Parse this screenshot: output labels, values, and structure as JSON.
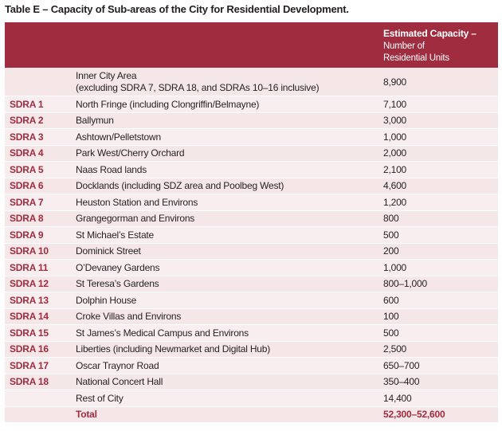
{
  "title": "Table E – Capacity of Sub-areas of the City for Residential Development.",
  "header": {
    "capacity_title": "Estimated Capacity –",
    "capacity_subtitle": "Number of\nResidential Units"
  },
  "rows": [
    {
      "code": "",
      "area_line1": "Inner City Area",
      "area_line2": "(excluding SDRA 7, SDRA 18, and SDRAs 10–16 inclusive)",
      "capacity": "8,900"
    },
    {
      "code": "SDRA 1",
      "area": "North Fringe (including Clongriffin/Belmayne)",
      "capacity": "7,100"
    },
    {
      "code": "SDRA 2",
      "area": "Ballymun",
      "capacity": "3,000"
    },
    {
      "code": "SDRA 3",
      "area": "Ashtown/Pelletstown",
      "capacity": "1,000"
    },
    {
      "code": "SDRA 4",
      "area": "Park West/Cherry Orchard",
      "capacity": "2,000"
    },
    {
      "code": "SDRA 5",
      "area": "Naas Road lands",
      "capacity": "2,100"
    },
    {
      "code": "SDRA 6",
      "area": "Docklands (including SDZ area and Poolbeg West)",
      "capacity": "4,600"
    },
    {
      "code": "SDRA 7",
      "area": "Heuston Station and Environs",
      "capacity": "1,200"
    },
    {
      "code": "SDRA 8",
      "area": "Grangegorman and Environs",
      "capacity": "800"
    },
    {
      "code": "SDRA 9",
      "area": "St Michael’s Estate",
      "capacity": "500"
    },
    {
      "code": "SDRA 10",
      "area": "Dominick Street",
      "capacity": "200"
    },
    {
      "code": "SDRA 11",
      "area": "O’Devaney Gardens",
      "capacity": "1,000"
    },
    {
      "code": "SDRA 12",
      "area": "St Teresa’s Gardens",
      "capacity": "800–1,000"
    },
    {
      "code": "SDRA 13",
      "area": "Dolphin House",
      "capacity": "600"
    },
    {
      "code": "SDRA 14",
      "area": "Croke Villas and Environs",
      "capacity": "100"
    },
    {
      "code": "SDRA 15",
      "area": "St James’s Medical Campus and Environs",
      "capacity": "500"
    },
    {
      "code": "SDRA 16",
      "area": "Liberties (including Newmarket and Digital Hub)",
      "capacity": "2,500"
    },
    {
      "code": "SDRA 17",
      "area": "Oscar Traynor Road",
      "capacity": "650–700"
    },
    {
      "code": "SDRA 18",
      "area": "National Concert Hall",
      "capacity": "350–400"
    },
    {
      "code": "",
      "area": "Rest of City",
      "capacity": "14,400"
    }
  ],
  "total": {
    "label": "Total",
    "capacity": "52,300–52,600"
  }
}
